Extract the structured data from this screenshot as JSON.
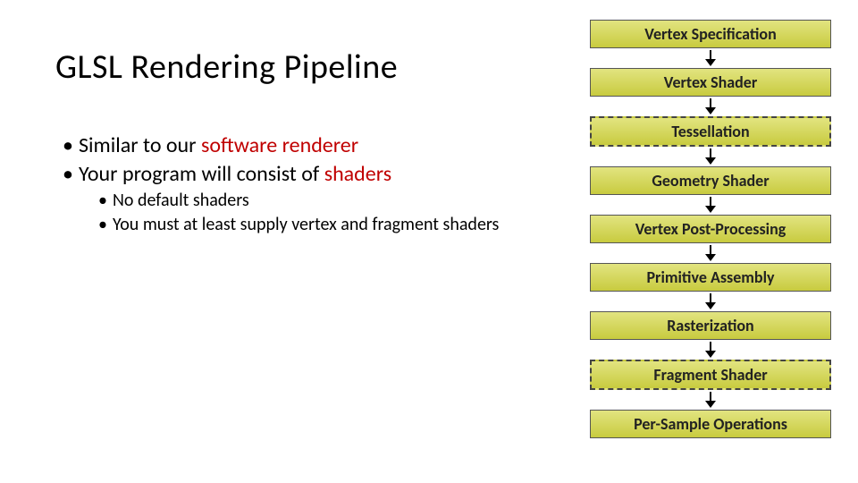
{
  "title": "GLSL Rendering Pipeline",
  "bullets": {
    "b1_pre": "Similar to our ",
    "b1_hl": "software renderer",
    "b2_pre": "Your program will consist of ",
    "b2_hl": "shaders",
    "b2a": "No default shaders",
    "b2b": "You must at least supply vertex and fragment shaders"
  },
  "pipeline": {
    "s1": "Vertex Specification",
    "s2": "Vertex Shader",
    "s3": "Tessellation",
    "s4": "Geometry Shader",
    "s5": "Vertex Post-Processing",
    "s6": "Primitive Assembly",
    "s7": "Rasterization",
    "s8": "Fragment Shader",
    "s9": "Per-Sample Operations"
  }
}
